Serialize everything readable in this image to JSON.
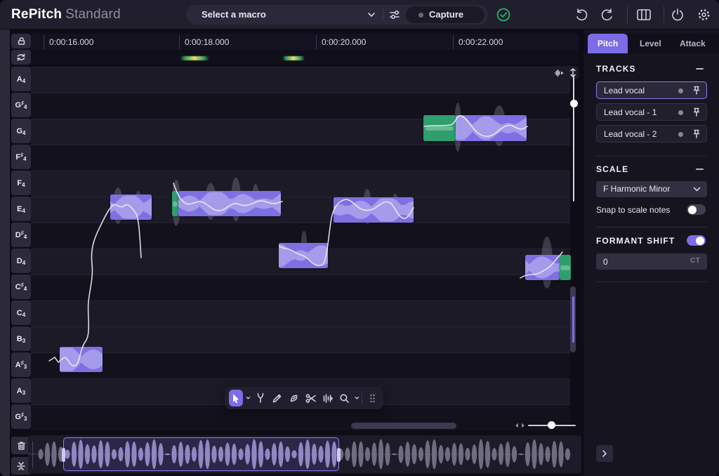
{
  "app": {
    "brand": "RePitch",
    "edition": "Standard"
  },
  "topbar": {
    "macro_label": "Select a macro",
    "capture_label": "Capture"
  },
  "ruler": {
    "ticks": [
      "0:00:16.000",
      "0:00:18.000",
      "0:00:20.000",
      "0:00:22.000"
    ]
  },
  "notes": [
    {
      "n": "A",
      "acc": "",
      "o": "4"
    },
    {
      "n": "G",
      "acc": "♯",
      "o": "4"
    },
    {
      "n": "G",
      "acc": "",
      "o": "4"
    },
    {
      "n": "F",
      "acc": "♯",
      "o": "4"
    },
    {
      "n": "F",
      "acc": "",
      "o": "4"
    },
    {
      "n": "E",
      "acc": "",
      "o": "4"
    },
    {
      "n": "D",
      "acc": "♯",
      "o": "4"
    },
    {
      "n": "D",
      "acc": "",
      "o": "4"
    },
    {
      "n": "C",
      "acc": "♯",
      "o": "4"
    },
    {
      "n": "C",
      "acc": "",
      "o": "4"
    },
    {
      "n": "B",
      "acc": "",
      "o": "3"
    },
    {
      "n": "A",
      "acc": "♯",
      "o": "3"
    },
    {
      "n": "A",
      "acc": "",
      "o": "3"
    },
    {
      "n": "G",
      "acc": "♯",
      "o": "3"
    }
  ],
  "panel": {
    "tabs": {
      "pitch": "Pitch",
      "level": "Level",
      "attack": "Attack",
      "active": "Pitch"
    },
    "tracks": {
      "title": "TRACKS",
      "items": [
        {
          "label": "Lead vocal",
          "selected": true
        },
        {
          "label": "Lead vocal - 1",
          "selected": false
        },
        {
          "label": "Lead vocal - 2",
          "selected": false
        }
      ]
    },
    "scale": {
      "title": "SCALE",
      "value": "F Harmonic Minor",
      "snap_label": "Snap to scale notes",
      "snap_on": false
    },
    "formant": {
      "title": "FORMANT SHIFT",
      "on": true,
      "value": "0",
      "unit": "CT"
    }
  },
  "colors": {
    "accent": "#7b6ce8",
    "note_block": "#7e70e2",
    "captured_green": "#2e9e6c",
    "status_check": "#27b36a"
  },
  "icons": {
    "macro-chevron-icon": "chevron-down",
    "macro-settings-icon": "mini-sliders",
    "status-check-icon": "check-circle",
    "undo-icon": "arc-arrow-left",
    "redo-icon": "arc-arrow-right",
    "columns-icon": "panel-columns",
    "power-icon": "power",
    "gear-icon": "gear",
    "lock-icon": "open-padlock",
    "loop-icon": "repeat-arrows",
    "trash-icon": "bin",
    "split-icon": "converging-arrows",
    "select-tool-icon": "cursor-arrow",
    "fork-tool-icon": "tuning-fork",
    "pencil-tool-icon": "pencil",
    "nib-tool-icon": "pen-nib",
    "scissors-tool-icon": "scissors",
    "warp-tool-icon": "warp-bars",
    "zoom-tool-icon": "magnifier",
    "drag-handle-icon": "dot-grid",
    "h-resize-icon": "left-right-arrows",
    "follow-icon": "waveform-cursor",
    "v-scroll-icon": "up-down-arrows",
    "pin-icon": "pushpin",
    "track-dot-icon": "dot"
  }
}
